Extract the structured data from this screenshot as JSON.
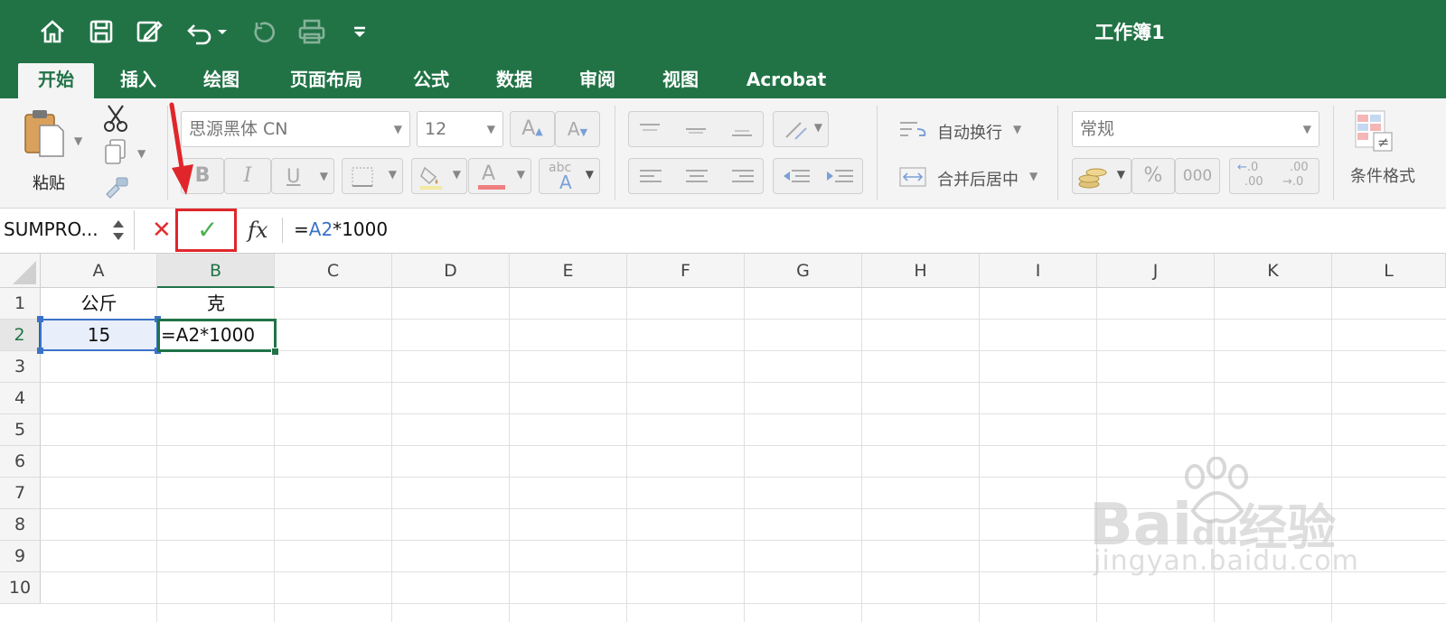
{
  "title_bar": {
    "workbook_title": "工作簿1",
    "icons": [
      "home-icon",
      "save-icon",
      "edit-icon",
      "undo-icon",
      "undo-dropdown-icon",
      "redo-icon",
      "print-icon",
      "customize-toolbar-icon"
    ],
    "color": "#217346"
  },
  "tabs": [
    {
      "label": "开始",
      "active": true
    },
    {
      "label": "插入"
    },
    {
      "label": "绘图"
    },
    {
      "label": "页面布局"
    },
    {
      "label": "公式"
    },
    {
      "label": "数据"
    },
    {
      "label": "审阅"
    },
    {
      "label": "视图"
    },
    {
      "label": "Acrobat"
    }
  ],
  "ribbon": {
    "paste_label": "粘贴",
    "font_name": "思源黑体 CN",
    "font_size": "12",
    "bold": "B",
    "italic": "I",
    "underline": "U",
    "increase_font": "A",
    "decrease_font": "A",
    "font_color_letter": "A",
    "abc_label": "abc",
    "wrap_text": "自动换行",
    "merge_center": "合并后居中",
    "number_format": "常规",
    "percent": "%",
    "thousands": "000",
    "inc_decimal": ".0",
    "inc_decimal2": ".00",
    "dec_decimal": ".00",
    "dec_decimal2": "→.0",
    "conditional_format": "条件格式"
  },
  "formula_bar": {
    "name_box": "SUMPRO...",
    "cancel_symbol": "✕",
    "enter_symbol": "✓",
    "fx_label": "fx",
    "formula_prefix": "=",
    "formula_ref": "A2",
    "formula_suffix": "*1000"
  },
  "grid": {
    "columns": [
      "A",
      "B",
      "C",
      "D",
      "E",
      "F",
      "G",
      "H",
      "I",
      "J",
      "K",
      "L"
    ],
    "selected_column": "B",
    "rows": [
      "1",
      "2",
      "3",
      "4",
      "5",
      "6",
      "7",
      "8",
      "9",
      "10"
    ],
    "selected_row": "2",
    "cells": {
      "A1": "公斤",
      "B1": "克",
      "A2": "15",
      "B2": "=A2*1000"
    }
  },
  "watermark": {
    "brand_latin": "Bai",
    "brand_du": "du",
    "brand_cn": "经验",
    "url": "jingyan.baidu.com"
  },
  "colors": {
    "accent_green": "#217346",
    "reference_blue": "#3b73c8",
    "annotation_red": "#e0262b",
    "cancel_red": "#e03030",
    "enter_green": "#4caf50"
  }
}
